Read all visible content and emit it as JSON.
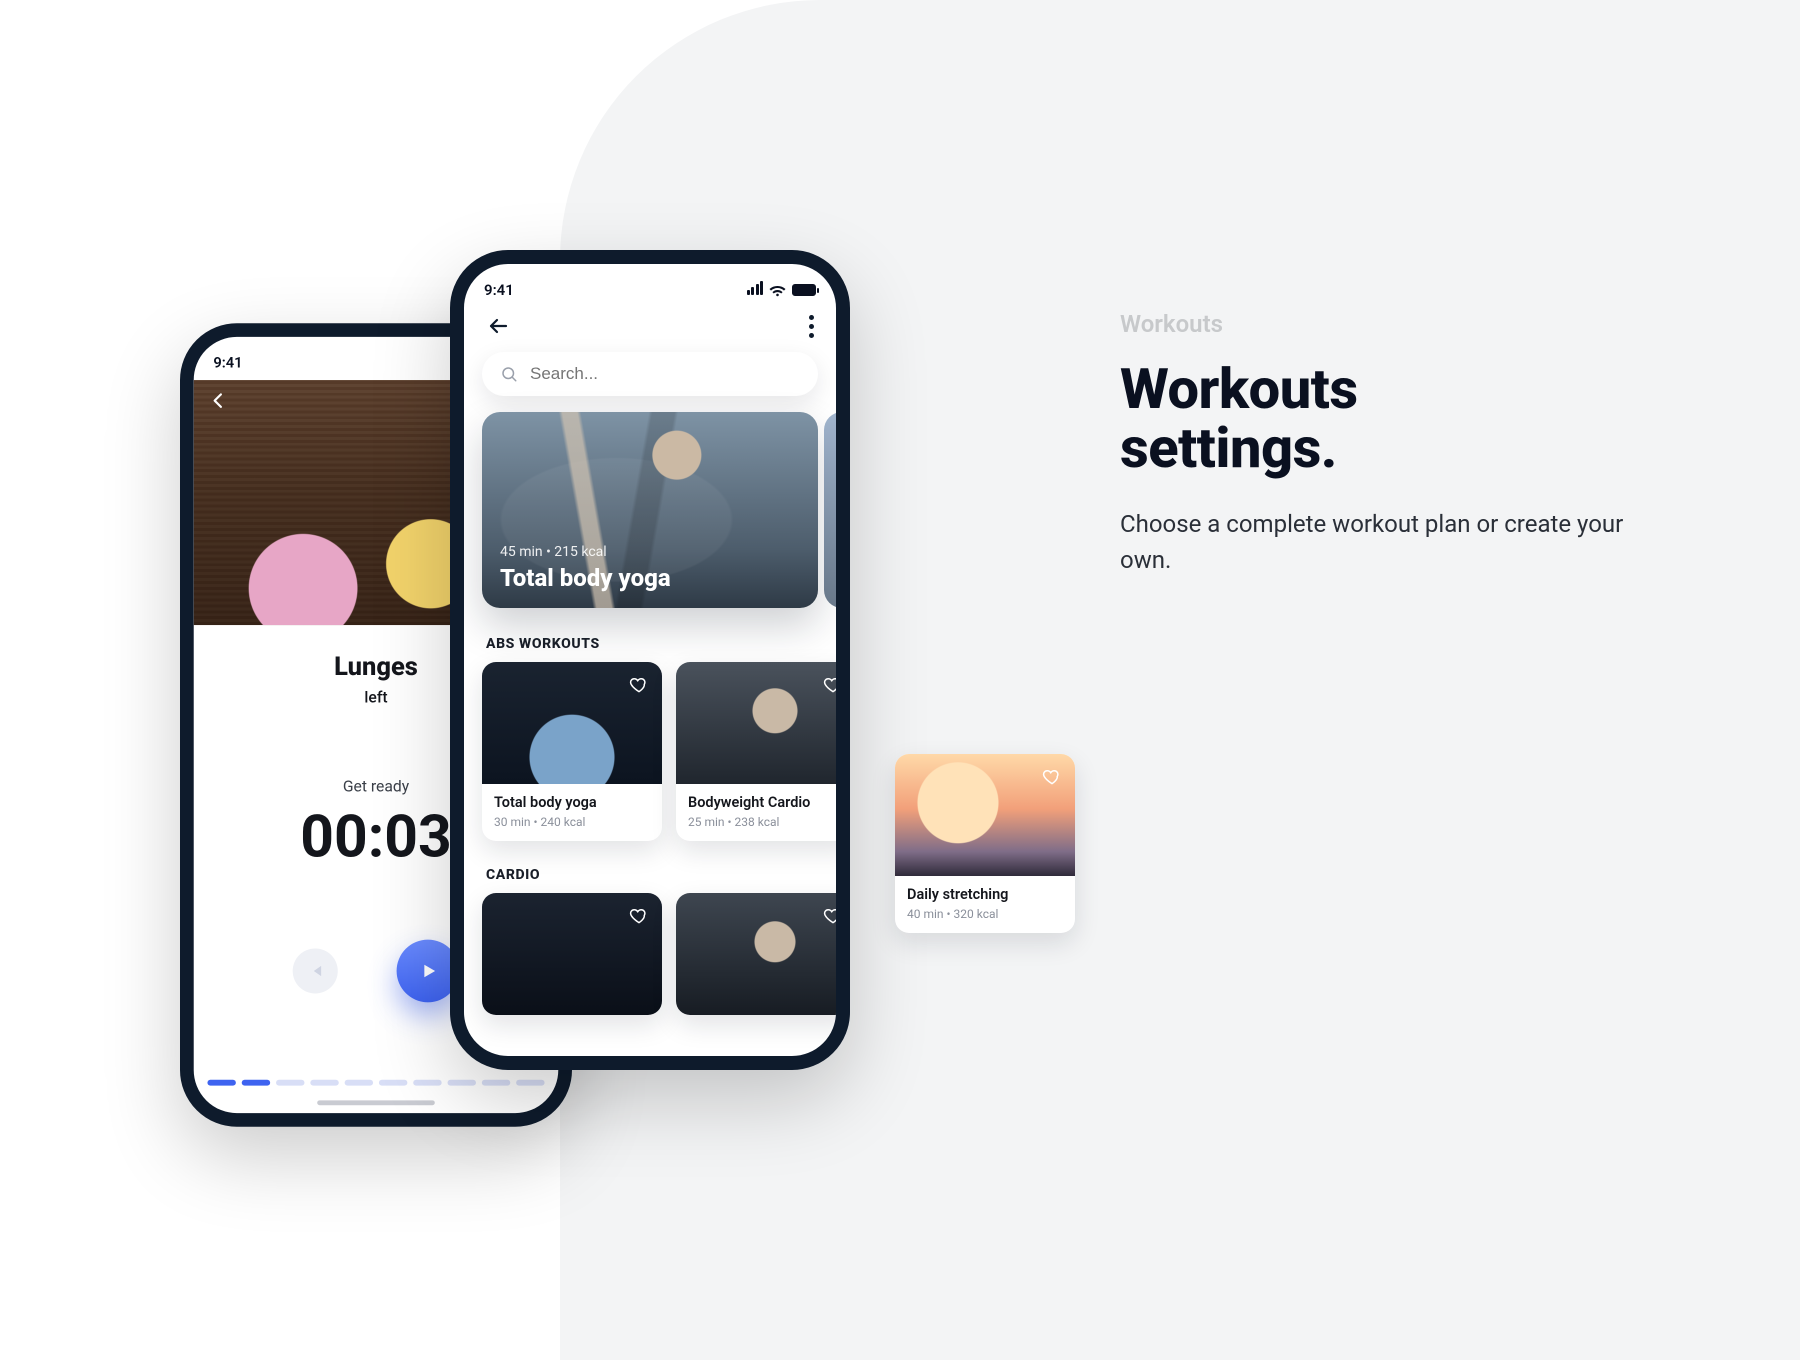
{
  "copy": {
    "eyebrow": "Workouts",
    "title_line1": "Workouts",
    "title_line2": "settings.",
    "desc": "Choose a complete workout plan or create your own."
  },
  "status": {
    "time": "9:41"
  },
  "player": {
    "exercise": "Lunges",
    "side": "left",
    "label": "Get ready",
    "timer": "00:03"
  },
  "search": {
    "placeholder": "Search..."
  },
  "hero": {
    "meta": "45 min • 215 kcal",
    "title": "Total body yoga"
  },
  "sections": {
    "abs": "ABS WORKOUTS",
    "cardio": "CARDIO"
  },
  "cards": {
    "a": {
      "title": "Total body yoga",
      "meta": "30 min • 240 kcal"
    },
    "b": {
      "title": "Bodyweight Cardio",
      "meta": "25 min • 238 kcal"
    },
    "c": {
      "title": "Daily stretching",
      "meta": "40 min • 320 kcal"
    }
  }
}
